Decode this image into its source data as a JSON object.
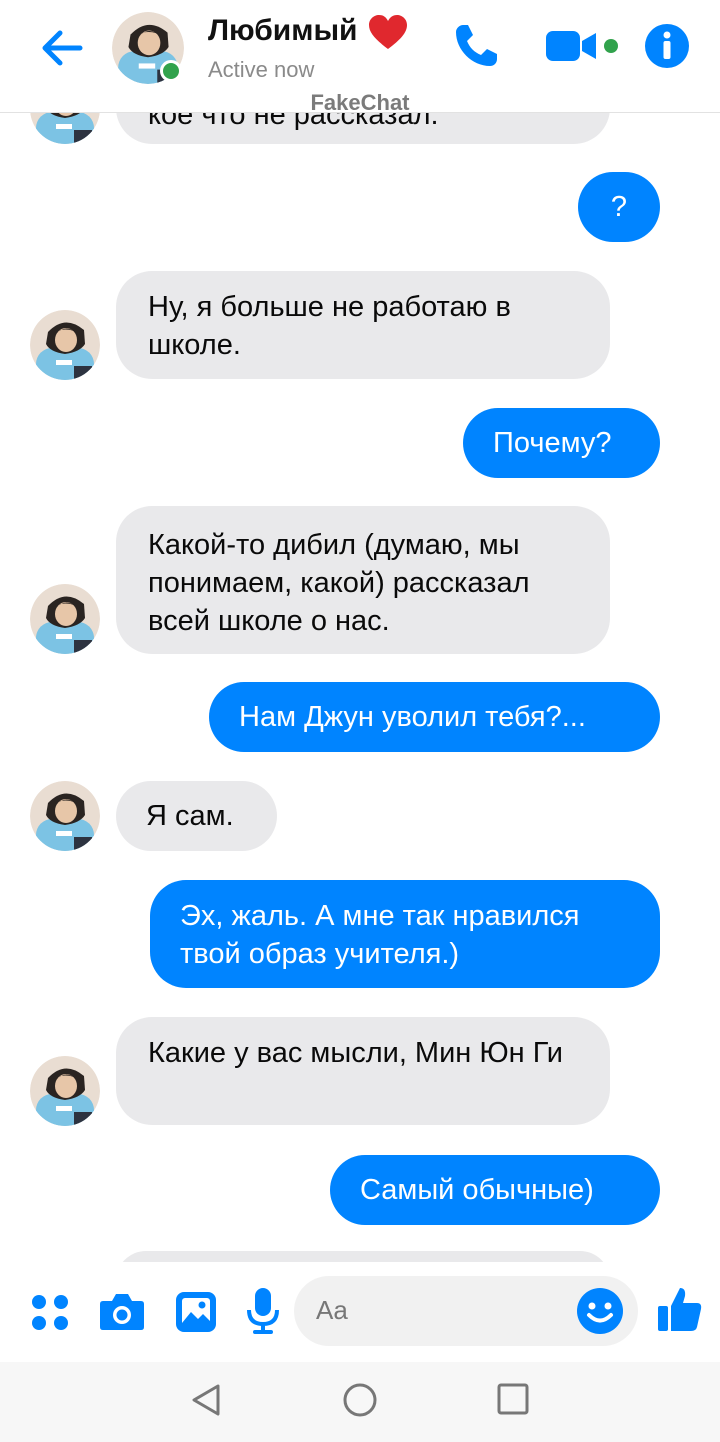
{
  "colors": {
    "accent": "#0084ff",
    "online": "#31a24c",
    "incoming_bubble": "#e9e9eb",
    "heart": "#e0282e"
  },
  "header": {
    "contact_name": "Любимый",
    "status": "Active now",
    "watermark": "FakeChat",
    "icons": [
      "arrow-left-icon",
      "heart-icon",
      "phone-icon",
      "video-camera-icon",
      "info-icon"
    ]
  },
  "messages": [
    {
      "from": "contact",
      "text": "кое что не рассказал."
    },
    {
      "from": "me",
      "text": "?"
    },
    {
      "from": "contact",
      "text": "Ну, я больше не работаю в школе."
    },
    {
      "from": "me",
      "text": "Почему?"
    },
    {
      "from": "contact",
      "text": "Какой-то дибил (думаю, мы понимаем, какой) рассказал всей школе о нас."
    },
    {
      "from": "me",
      "text": "Нам Джун уволил тебя?..."
    },
    {
      "from": "contact",
      "text": "Я сам."
    },
    {
      "from": "me",
      "text": "Эх, жаль. А мне так нравился твой образ учителя.)"
    },
    {
      "from": "contact",
      "text": "Какие у вас мысли, Мин Юн Ги"
    },
    {
      "from": "me",
      "text": "Самый обычные)"
    }
  ],
  "composer": {
    "placeholder": "Aa",
    "icons": [
      "apps-icon",
      "camera-icon",
      "image-icon",
      "microphone-icon",
      "emoji-icon",
      "thumbs-up-icon"
    ]
  },
  "navbar": {
    "icons": [
      "back-triangle-icon",
      "home-circle-icon",
      "recents-square-icon"
    ]
  }
}
